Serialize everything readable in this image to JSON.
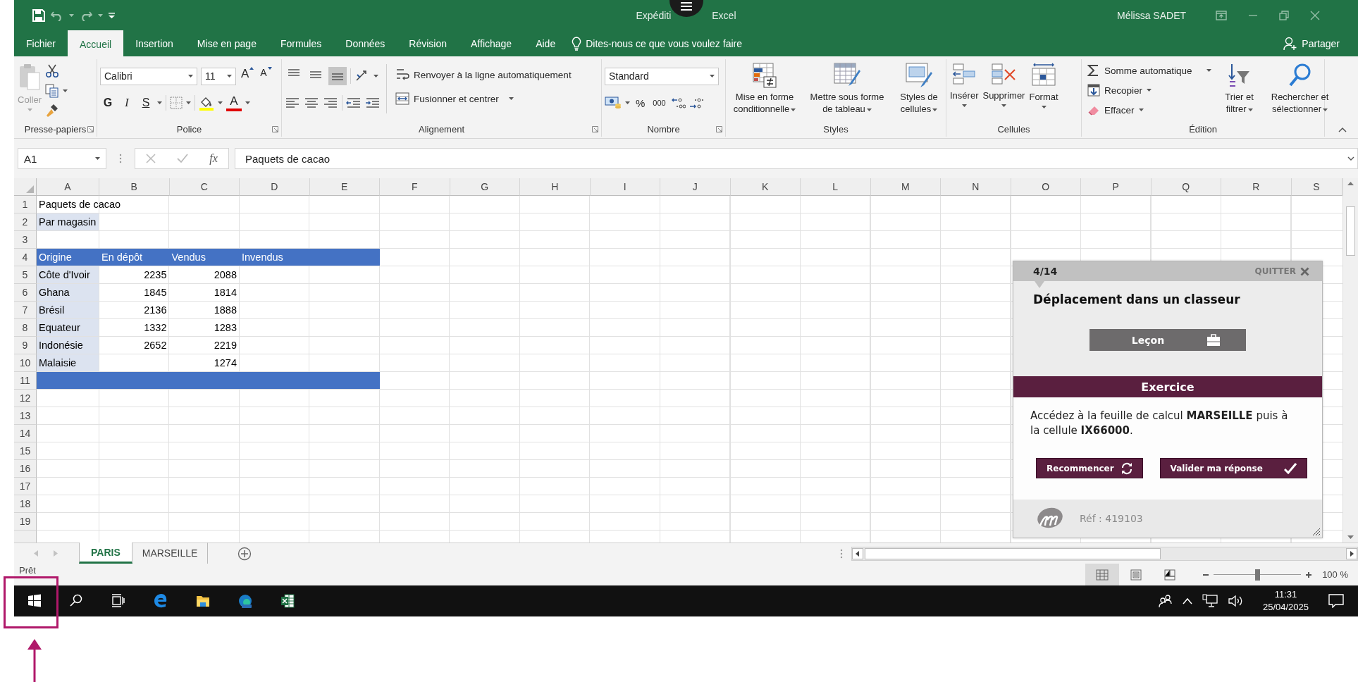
{
  "title_bar": {
    "title_start": "Expéditi",
    "title_end": "Excel",
    "user": "Mélissa SADET"
  },
  "menu_tabs": [
    {
      "label": "Fichier",
      "selected": false
    },
    {
      "label": "Accueil",
      "selected": true
    },
    {
      "label": "Insertion",
      "selected": false
    },
    {
      "label": "Mise en page",
      "selected": false
    },
    {
      "label": "Formules",
      "selected": false
    },
    {
      "label": "Données",
      "selected": false
    },
    {
      "label": "Révision",
      "selected": false
    },
    {
      "label": "Affichage",
      "selected": false
    },
    {
      "label": "Aide",
      "selected": false
    }
  ],
  "tell_me": "Dites-nous ce que vous voulez faire",
  "share": "Partager",
  "ribbon": [
    {
      "label": "Presse-papiers",
      "buttons": [
        {
          "label": "Coller",
          "disabled": true
        }
      ]
    },
    {
      "label": "Police",
      "font": "Calibri",
      "size_field": "11",
      "grow": "A",
      "shrink": "A",
      "styles": [
        "G",
        "I",
        "S"
      ],
      "color_letter": "A"
    },
    {
      "label": "Alignement",
      "vertical_align": [
        {
          "selected": false
        },
        {
          "selected": false
        },
        {
          "selected": true
        }
      ],
      "buttons": [
        {
          "label": "Renvoyer à la ligne automatiquement"
        },
        {
          "label": "Fusionner et centrer"
        }
      ]
    },
    {
      "label": "Nombre",
      "format": "Standard",
      "symbols": [
        "%",
        "000"
      ]
    },
    {
      "label": "Styles",
      "buttons": [
        {
          "label": "Mise en forme conditionnelle"
        },
        {
          "label": "Mettre sous forme de tableau"
        },
        {
          "label": "Styles de cellules"
        }
      ]
    },
    {
      "label": "Cellules",
      "buttons": [
        {
          "label": "Insérer"
        },
        {
          "label": "Supprimer"
        },
        {
          "label": "Format"
        }
      ]
    },
    {
      "label": "Édition",
      "buttons": [
        {
          "label": "Somme automatique"
        },
        {
          "label": "Recopier"
        },
        {
          "label": "Effacer"
        },
        {
          "label": "Trier et filtrer"
        },
        {
          "label": "Rechercher et sélectionner"
        }
      ]
    }
  ],
  "formula_bar": {
    "name_box": "A1",
    "function_label": "fx",
    "value": "Paquets de cacao"
  },
  "sheet": {
    "columns": [
      "A",
      "B",
      "C",
      "D",
      "E",
      "F",
      "G",
      "H",
      "I",
      "J",
      "K",
      "L",
      "M",
      "N",
      "O",
      "P",
      "Q",
      "R",
      "S"
    ],
    "rows": [
      {
        "number": "1",
        "cells": [
          {
            "text": "Paquets de cacao",
            "kind": "text"
          }
        ]
      },
      {
        "number": "2",
        "cells": [
          {
            "text": "Par magasin",
            "kind": "highlighted"
          }
        ]
      },
      {
        "number": "3"
      },
      {
        "number": "4",
        "cells": [
          {
            "text": "Origine",
            "kind": "header"
          },
          {
            "text": "En dépôt",
            "kind": "header"
          },
          {
            "text": "Vendus",
            "kind": "header"
          },
          {
            "text": "Invendus",
            "kind": "header"
          },
          {
            "kind": "header"
          }
        ]
      },
      {
        "number": "5",
        "cells": [
          {
            "text": "Côte d'Ivoir",
            "kind": "highlighted"
          },
          {
            "text": "2235",
            "kind": "number"
          },
          {
            "text": "2088",
            "kind": "number"
          }
        ]
      },
      {
        "number": "6",
        "cells": [
          {
            "text": "Ghana",
            "kind": "highlighted"
          },
          {
            "text": "1845",
            "kind": "number"
          },
          {
            "text": "1814",
            "kind": "number"
          }
        ]
      },
      {
        "number": "7",
        "cells": [
          {
            "text": "Brésil",
            "kind": "highlighted"
          },
          {
            "text": "2136",
            "kind": "number"
          },
          {
            "text": "1888",
            "kind": "number"
          }
        ]
      },
      {
        "number": "8",
        "cells": [
          {
            "text": "Equateur",
            "kind": "highlighted"
          },
          {
            "text": "1332",
            "kind": "number"
          },
          {
            "text": "1283",
            "kind": "number"
          }
        ]
      },
      {
        "number": "9",
        "cells": [
          {
            "text": "Indonésie",
            "kind": "highlighted"
          },
          {
            "text": "2652",
            "kind": "number"
          },
          {
            "text": "2219",
            "kind": "number"
          }
        ]
      },
      {
        "number": "10",
        "cells": [
          {
            "text": "Malaisie",
            "kind": "highlighted"
          },
          {
            "kind": "empty"
          },
          {
            "text": "1274",
            "kind": "number"
          }
        ]
      },
      {
        "number": "11",
        "cells": [
          {
            "kind": "band"
          },
          {
            "kind": "band"
          },
          {
            "kind": "band"
          },
          {
            "kind": "band"
          },
          {
            "kind": "band"
          }
        ]
      },
      {
        "number": "12"
      },
      {
        "number": "13"
      },
      {
        "number": "14"
      },
      {
        "number": "15"
      },
      {
        "number": "16"
      },
      {
        "number": "17"
      },
      {
        "number": "18"
      },
      {
        "number": "19"
      }
    ]
  },
  "sheet_tabs": [
    {
      "label": "PARIS",
      "selected": true
    },
    {
      "label": "MARSEILLE",
      "selected": false
    }
  ],
  "status_bar": {
    "status": "Prêt",
    "views": [
      {
        "selected": true
      },
      {
        "selected": false
      },
      {
        "selected": false
      }
    ],
    "zoom": {
      "level": 0.5,
      "reading": "100 %"
    }
  },
  "taskbar": {
    "time": "11:31",
    "date": "25/04/2025"
  },
  "tutorial": {
    "step": "4/14",
    "quit": "QUITTER",
    "title": "Déplacement dans un classeur",
    "lesson": "Leçon",
    "section": "Exercice",
    "instruction": "Accédez à la feuille de calcul **MARSEILLE** puis à la cellule **IX66000**.",
    "buttons": [
      "Recommencer",
      "Valider ma réponse"
    ],
    "reference": "Réf : 419103"
  }
}
